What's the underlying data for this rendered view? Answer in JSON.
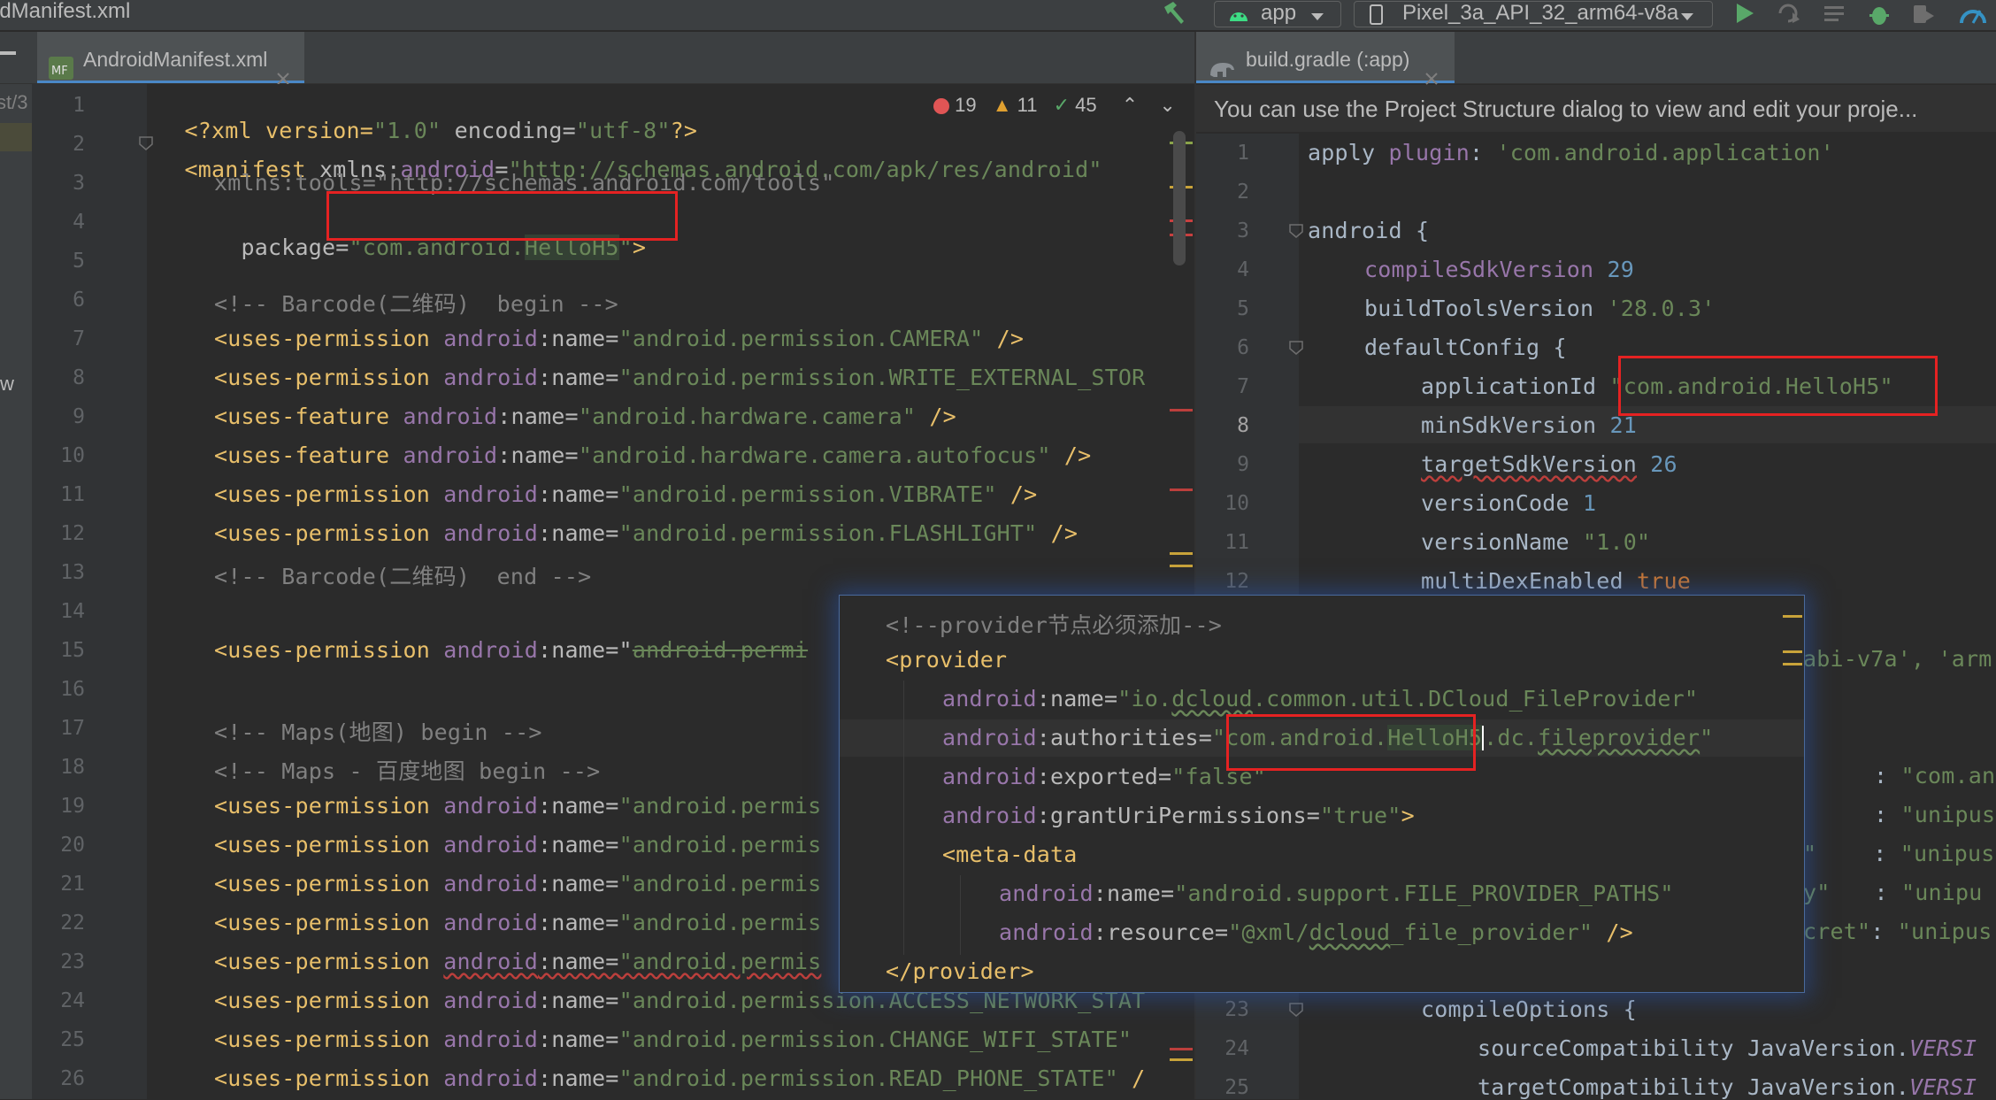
{
  "window": {
    "title": "idManifest.xml"
  },
  "toolbar": {
    "run_config": "app",
    "device": "Pixel_3a_API_32_arm64-v8a"
  },
  "left_editor": {
    "tab": "AndroidManifest.xml",
    "project_strip_text": "st/3",
    "inspections": {
      "errors": "19",
      "warnings": "11",
      "ok": "45"
    },
    "line_numbers": [
      "1",
      "2",
      "3",
      "4",
      "5",
      "6",
      "7",
      "8",
      "9",
      "10",
      "11",
      "12",
      "13",
      "14",
      "15",
      "16",
      "17",
      "18",
      "19",
      "20",
      "21",
      "22",
      "23",
      "24",
      "25",
      "26"
    ],
    "lines": {
      "l1": [
        "<?xml version=",
        "\"1.0\"",
        " encoding=",
        "\"utf-8\"",
        "?>"
      ],
      "l2": [
        "<manifest ",
        "xmlns:",
        "android",
        "=",
        "\"http://schemas.android.com/apk/res/android\""
      ],
      "l3": [
        "xmlns:tools=\"http://schemas.android.com/tools\""
      ],
      "l4": [
        "package=",
        "\"com.android.",
        "HelloH5",
        "\"",
        ">"
      ],
      "l6": [
        "<!-- Barcode(二维码)  begin -->"
      ],
      "l7": [
        "<uses-permission ",
        "android",
        ":name=",
        "\"android.permission.CAMERA\"",
        " />"
      ],
      "l8": [
        "<uses-permission ",
        "android",
        ":name=",
        "\"android.permission.WRITE_EXTERNAL_STOR"
      ],
      "l9": [
        "<uses-feature ",
        "android",
        ":name=",
        "\"android.hardware.camera\"",
        " />"
      ],
      "l10": [
        "<uses-feature ",
        "android",
        ":name=",
        "\"android.hardware.camera.autofocus\"",
        " />"
      ],
      "l11": [
        "<uses-permission ",
        "android",
        ":name=",
        "\"android.permission.VIBRATE\"",
        " />"
      ],
      "l12": [
        "<uses-permission ",
        "android",
        ":name=",
        "\"android.permission.FLASHLIGHT\"",
        " />"
      ],
      "l13": [
        "<!-- Barcode(二维码)  end -->"
      ],
      "l15": [
        "<uses-permission ",
        "android",
        ":name=\"",
        "android.permi"
      ],
      "l17": [
        "<!-- Maps(地图) begin -->"
      ],
      "l18": [
        "<!-- Maps - 百度地图 begin -->"
      ],
      "l19": [
        "<uses-permission ",
        "android",
        ":name=",
        "\"android.permis"
      ],
      "l20": [
        "<uses-permission ",
        "android",
        ":name=",
        "\"android.permis"
      ],
      "l21": [
        "<uses-permission ",
        "android",
        ":name=",
        "\"android.permis"
      ],
      "l22": [
        "<uses-permission ",
        "android",
        ":name=",
        "\"android.permis"
      ],
      "l23": [
        "<uses-permission ",
        "android",
        ":name=",
        "\"android.permis"
      ],
      "l24": [
        "<uses-permission ",
        "android",
        ":name=",
        "\"android.permission.ACCESS_NETWORK_STAT"
      ],
      "l25": [
        "<uses-permission ",
        "android",
        ":name=",
        "\"android.permission.CHANGE_WIFI_STATE\""
      ],
      "l26": [
        "<uses-permission ",
        "android",
        ":name=",
        "\"android.permission.READ_PHONE_STATE\"",
        " /"
      ]
    }
  },
  "right_editor": {
    "tab": "build.gradle (:app)",
    "banner": "You can use the Project Structure dialog to view and edit your proje...",
    "line_numbers": [
      "1",
      "2",
      "3",
      "4",
      "5",
      "6",
      "7",
      "8",
      "9",
      "10",
      "11",
      "12",
      "23",
      "24",
      "25"
    ],
    "lines": {
      "r1": [
        "apply ",
        "plugin",
        ": ",
        "'com.android.application'"
      ],
      "r3": [
        "android {"
      ],
      "r4": [
        "compileSdkVersion ",
        "29"
      ],
      "r5": [
        "buildToolsVersion ",
        "'28.0.3'"
      ],
      "r6": [
        "defaultConfig {"
      ],
      "r7": [
        "applicationId ",
        "\"com.android.HelloH5\""
      ],
      "r8": [
        "minSdkVersion ",
        "21"
      ],
      "r9": [
        "targetSdkVersion",
        " 26"
      ],
      "r10": [
        "versionCode ",
        "1"
      ],
      "r11": [
        "versionName ",
        "\"1.0\""
      ],
      "r12": [
        "multiDexEnabled ",
        "true"
      ],
      "r_abi": [
        "abi-v7a', 'arm"
      ],
      "r_m1": [
        ": ",
        "\"com.an"
      ],
      "r_m2": [
        ": ",
        "\"unipus"
      ],
      "r_m3": [
        "\"",
        ": ",
        "\"unipus"
      ],
      "r_m4": [
        "y\"",
        ": ",
        "\"unipu"
      ],
      "r_m5": [
        "cret\"",
        ": ",
        "\"unipus"
      ],
      "r23": [
        "compileOptions {"
      ],
      "r24": [
        "sourceCompatibility JavaVersion.",
        "VERSI"
      ],
      "r25": [
        "targetCompatibility JavaVersion.",
        "VERSI"
      ]
    }
  },
  "popup": {
    "p1": [
      "<!--provider节点必须添加-->"
    ],
    "p2": [
      "<provider"
    ],
    "p3": [
      "android",
      ":name=",
      "\"io.",
      "dcloud",
      ".common.util.DCloud_FileProvider\""
    ],
    "p4": [
      "android",
      ":authorities=",
      "\"com.android.",
      "HelloH5",
      ".dc.",
      "fileprovider",
      "\""
    ],
    "p5": [
      "android",
      ":exported=",
      "\"false\""
    ],
    "p6": [
      "android",
      ":grantUriPermissions=",
      "\"true\"",
      ">"
    ],
    "p7": [
      "<meta-data"
    ],
    "p8": [
      "android",
      ":name=",
      "\"android.support.FILE_PROVIDER_PATHS\""
    ],
    "p9": [
      "android",
      ":resource=",
      "\"@xml/",
      "dcloud",
      "_file_provider\"",
      " />"
    ],
    "p10": [
      "</provider>"
    ]
  },
  "colors": {
    "highlight_box": "#e52222",
    "popup_border": "#4a6a9c",
    "accent": "#4a88c7"
  }
}
